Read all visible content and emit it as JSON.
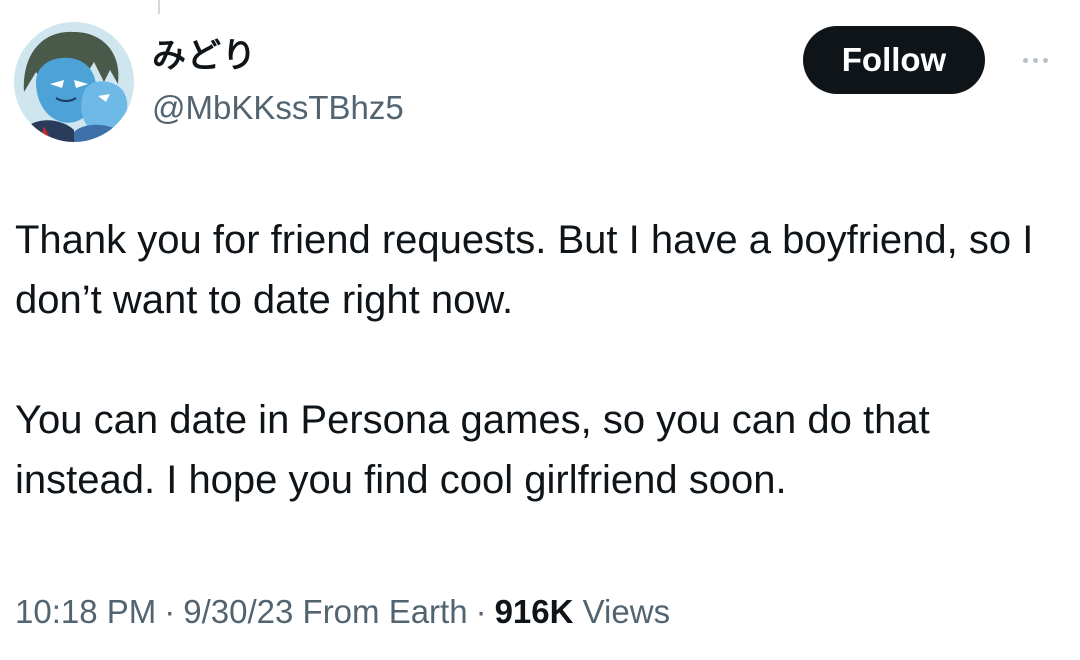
{
  "author": {
    "display_name": "みどり",
    "handle": "@MbKKssTBhz5"
  },
  "actions": {
    "follow_label": "Follow",
    "more_icon": "more-horizontal-icon"
  },
  "tweet": {
    "paragraphs": [
      "Thank you for friend requests. But I have a boyfriend, so I don’t want to date right now.",
      "You can date in Persona games, so you can do that instead. I hope you find cool girlfriend soon."
    ],
    "time": "10:18 PM",
    "date": "9/30/23",
    "location": "From Earth",
    "views_count": "916K",
    "views_label": "Views"
  },
  "colors": {
    "text_primary": "#0f1419",
    "text_secondary": "#536471",
    "follow_bg": "#0f1419"
  }
}
